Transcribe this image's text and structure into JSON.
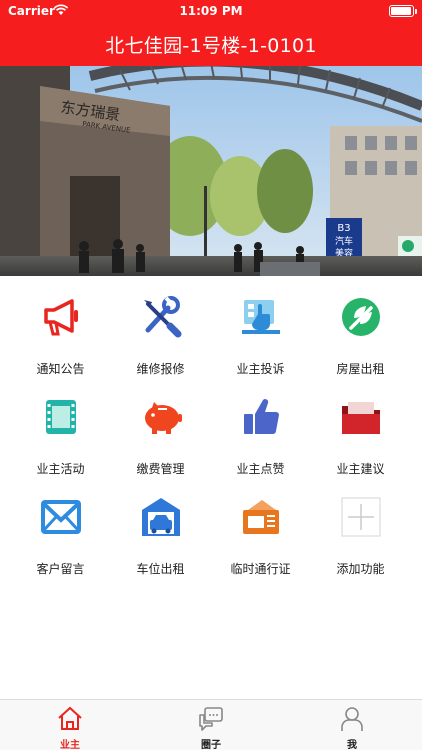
{
  "status_bar": {
    "carrier": "Carrier",
    "time": "11:09 PM"
  },
  "header": {
    "title": "北七佳园-1号楼-1-0101"
  },
  "banner": {
    "sign_text_1": "东方瑞景",
    "sign_text_2": "PARK AVENUE",
    "board_1": "B3",
    "board_2": "汽车",
    "board_3": "美容"
  },
  "features": [
    {
      "label": "通知公告",
      "icon": "megaphone-icon",
      "color": "#e8251f"
    },
    {
      "label": "维修报修",
      "icon": "tools-icon",
      "color": "#3a63c4"
    },
    {
      "label": "业主投诉",
      "icon": "complaint-icon",
      "color": "#4aa9e0"
    },
    {
      "label": "房屋出租",
      "icon": "rent-icon",
      "color": "#27b36a"
    },
    {
      "label": "业主活动",
      "icon": "film-icon",
      "color": "#22b4a8"
    },
    {
      "label": "缴费管理",
      "icon": "piggy-bank-icon",
      "color": "#f0461f"
    },
    {
      "label": "业主点赞",
      "icon": "thumbs-up-icon",
      "color": "#4b66c8"
    },
    {
      "label": "业主建议",
      "icon": "folder-icon",
      "color": "#d1242b"
    },
    {
      "label": "客户留言",
      "icon": "mail-icon",
      "color": "#2d8be0"
    },
    {
      "label": "车位出租",
      "icon": "garage-icon",
      "color": "#2f78d8"
    },
    {
      "label": "临时通行证",
      "icon": "ticket-icon",
      "color": "#e8761f"
    },
    {
      "label": "添加功能",
      "icon": "add-icon",
      "color": "#cccccc"
    }
  ],
  "tabbar": {
    "items": [
      {
        "label": "业主",
        "icon": "home-icon",
        "active": true
      },
      {
        "label": "圈子",
        "icon": "chat-icon",
        "active": false
      },
      {
        "label": "我",
        "icon": "profile-icon",
        "active": false
      }
    ]
  },
  "colors": {
    "header": "#f51d1d",
    "active_tab": "#e8251f"
  }
}
